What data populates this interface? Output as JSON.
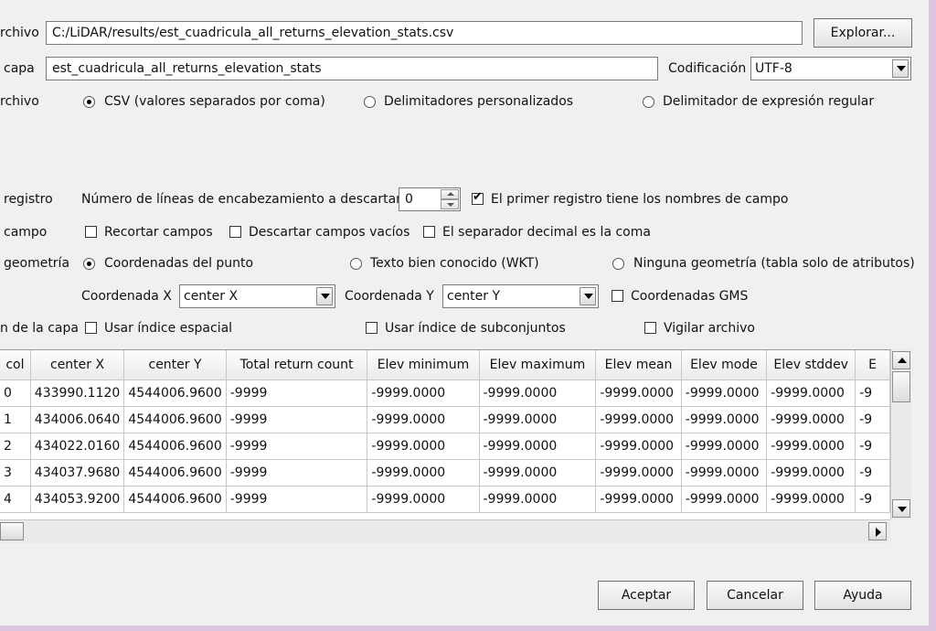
{
  "form": {
    "file_label": "rchivo",
    "file_path": "C:/LiDAR/results/est_cuadricula_all_returns_elevation_stats.csv",
    "browse_label": "Explorar...",
    "layer_label": "capa",
    "layer_name": "est_cuadricula_all_returns_elevation_stats",
    "encoding_label": "Codificación",
    "encoding_value": "UTF-8",
    "format_label": "rchivo",
    "format_options": [
      {
        "label": "CSV (valores separados por coma)",
        "checked": true
      },
      {
        "label": "Delimitadores personalizados",
        "checked": false
      },
      {
        "label": "Delimitador de expresión regular",
        "checked": false
      }
    ],
    "record_label": "registro",
    "skip_lines_label": "Número de líneas de encabezamiento a descartar",
    "skip_lines_value": "0",
    "first_record_label": "El primer registro tiene los nombres de campo",
    "first_record_checked": true,
    "field_label": "campo",
    "trim_fields_label": "Recortar campos",
    "discard_empty_label": "Descartar campos vacíos",
    "decimal_comma_label": "El separador decimal es la coma",
    "geometry_label": "geometría",
    "geometry_options": [
      {
        "label": "Coordenadas del punto",
        "checked": true
      },
      {
        "label": "Texto bien conocido (WKT)",
        "checked": false
      },
      {
        "label": "Ninguna geometría (tabla solo de atributos)",
        "checked": false
      }
    ],
    "x_coord_label": "Coordenada X",
    "x_coord_value": "center X",
    "y_coord_label": "Coordenada Y",
    "y_coord_value": "center Y",
    "dms_label": "Coordenadas GMS",
    "layer_settings_label": "n de la capa",
    "spatial_index_label": "Usar índice espacial",
    "subset_index_label": "Usar índice de subconjuntos",
    "watch_file_label": "Vigilar archivo"
  },
  "table": {
    "columns": [
      "col",
      "center X",
      "center Y",
      "Total return count",
      "Elev minimum",
      "Elev maximum",
      "Elev mean",
      "Elev mode",
      "Elev stddev",
      "E"
    ],
    "rows": [
      [
        "0",
        "433990.1120",
        "4544006.9600",
        "-9999",
        "-9999.0000",
        "-9999.0000",
        "-9999.0000",
        "-9999.0000",
        "-9999.0000",
        "-9"
      ],
      [
        "1",
        "434006.0640",
        "4544006.9600",
        "-9999",
        "-9999.0000",
        "-9999.0000",
        "-9999.0000",
        "-9999.0000",
        "-9999.0000",
        "-9"
      ],
      [
        "2",
        "434022.0160",
        "4544006.9600",
        "-9999",
        "-9999.0000",
        "-9999.0000",
        "-9999.0000",
        "-9999.0000",
        "-9999.0000",
        "-9"
      ],
      [
        "3",
        "434037.9680",
        "4544006.9600",
        "-9999",
        "-9999.0000",
        "-9999.0000",
        "-9999.0000",
        "-9999.0000",
        "-9999.0000",
        "-9"
      ],
      [
        "4",
        "434053.9200",
        "4544006.9600",
        "-9999",
        "-9999.0000",
        "-9999.0000",
        "-9999.0000",
        "-9999.0000",
        "-9999.0000",
        "-9"
      ]
    ]
  },
  "buttons": {
    "ok": "Aceptar",
    "cancel": "Cancelar",
    "help": "Ayuda"
  }
}
